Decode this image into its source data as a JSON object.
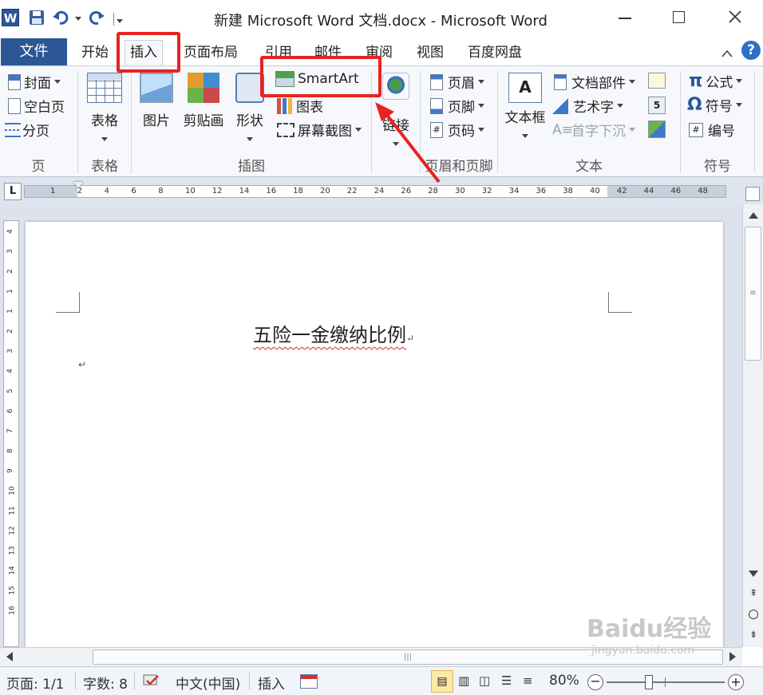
{
  "window": {
    "title": "新建 Microsoft Word 文档.docx - Microsoft Word",
    "min_icon": "minimize-icon",
    "max_icon": "maximize-icon",
    "close_icon": "close-icon"
  },
  "qat": {
    "app_icon": "word-app-icon",
    "save_icon": "save-icon",
    "undo_icon": "undo-icon",
    "redo_icon": "redo-icon"
  },
  "tabs": [
    {
      "label": "文件"
    },
    {
      "label": "开始"
    },
    {
      "label": "插入"
    },
    {
      "label": "页面布局"
    },
    {
      "label": "引用"
    },
    {
      "label": "邮件"
    },
    {
      "label": "审阅"
    },
    {
      "label": "视图"
    },
    {
      "label": "百度网盘"
    }
  ],
  "ribbon": {
    "page": {
      "label": "页",
      "cover": "封面",
      "blank": "空白页",
      "break": "分页"
    },
    "table": {
      "label": "表格",
      "btn": "表格"
    },
    "illust": {
      "label": "插图",
      "picture": "图片",
      "clipart": "剪贴画",
      "shapes": "形状",
      "smartart": "SmartArt",
      "chart": "图表",
      "screenshot": "屏幕截图"
    },
    "links": {
      "btn": "链接"
    },
    "header": {
      "label": "页眉和页脚",
      "header": "页眉",
      "footer": "页脚",
      "pagenum": "页码"
    },
    "text": {
      "label": "文本",
      "textbox": "文本框",
      "parts": "文档部件",
      "wordart": "艺术字",
      "dropcap": "首字下沉"
    },
    "symbols": {
      "label": "符号",
      "equation": "公式",
      "symbol": "符号",
      "number": "编号"
    }
  },
  "ruler": {
    "ticks": [
      "1",
      "2",
      "4",
      "6",
      "8",
      "10",
      "12",
      "14",
      "16",
      "18",
      "20",
      "22",
      "24",
      "26",
      "28",
      "30",
      "32",
      "34",
      "36",
      "38",
      "40",
      "42",
      "44",
      "46",
      "48"
    ]
  },
  "vruler": {
    "ticks": [
      "4",
      "3",
      "2",
      "1",
      "1",
      "2",
      "3",
      "4",
      "5",
      "6",
      "7",
      "8",
      "9",
      "10",
      "11",
      "12",
      "13",
      "14",
      "15",
      "16"
    ]
  },
  "document": {
    "heading": "五险一金缴纳比例",
    "para_mark": "↵"
  },
  "status": {
    "page": "页面: 1/1",
    "words": "字数: 8",
    "language": "中文(中国)",
    "mode": "插入",
    "zoom": "80%",
    "zoom_level": 0.8
  },
  "watermark": {
    "main": "Baidu经验",
    "sub": "jingyan.baidu.com"
  },
  "colors": {
    "file_tab": "#2b5797",
    "highlight": "#e8231f",
    "ribbon_bg": "#f6f8fb"
  }
}
